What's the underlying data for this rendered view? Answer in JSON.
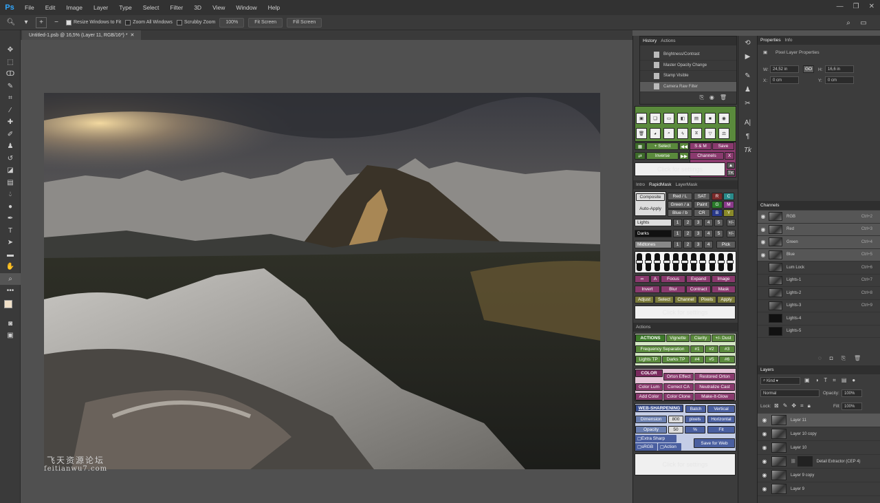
{
  "app": {
    "logo": "Ps"
  },
  "menu": [
    "File",
    "Edit",
    "Image",
    "Layer",
    "Type",
    "Select",
    "Filter",
    "3D",
    "View",
    "Window",
    "Help"
  ],
  "options": {
    "resize_windows": "Resize Windows to Fit",
    "zoom_all": "Zoom All Windows",
    "scrubby": "Scrubby Zoom",
    "zoom_value": "100%",
    "fit_screen": "Fit Screen",
    "fill_screen": "Fill Screen"
  },
  "document": {
    "tab_title": "Untitled-1.psb @ 16,5% (Layer 11, RGB/16*) *"
  },
  "watermark": {
    "line1": "飞天资源论坛",
    "line2": "feitianwu7.com"
  },
  "history": {
    "tabs": [
      "History",
      "Actions"
    ],
    "items": [
      "Brightness/Contrast",
      "Master Opacity Change",
      "Stamp Visible",
      "Camera Raw Filter"
    ],
    "selected_index": 3
  },
  "rapid": {
    "select": "+ Select",
    "sm": "S & M",
    "save": "Save",
    "inverse": "Inverse",
    "channels": "Channels",
    "x": "X",
    "click_settings": "Click for settings",
    "tabs": [
      "Intro",
      "RapidMask",
      "LayerMask"
    ],
    "composite": "Composite",
    "auto_apply": "Auto-Apply",
    "red": "Red / L",
    "green": "Green / a",
    "blue": "Blue / b",
    "sat": "SAT",
    "paint": "Paint",
    "cr": "CR",
    "lights": "Lights",
    "darks": "Darks",
    "midtones": "Midtones",
    "nums": [
      "1",
      "2",
      "3",
      "4",
      "5"
    ],
    "plus_minus": "+/-",
    "pick": "Pick",
    "row1": [
      "∞",
      "A",
      "Focus",
      "Expand",
      "Image"
    ],
    "row2": [
      "Invert",
      "Blur",
      "Contract",
      "Mask"
    ],
    "row3": [
      "Adjust",
      "Select",
      "Channel",
      "Pixels",
      "Apply"
    ],
    "click_settings2": "Click for settings"
  },
  "actions": {
    "title": "Actions",
    "actions_label": "ACTIONS",
    "vignette": "Vignette",
    "clarity": "Clarity",
    "dust": "+/- Dust",
    "freq": "Frequency Separation",
    "n1": "#1",
    "n2": "#2",
    "n3": "#3",
    "lights_tp": "Lights TP",
    "darks_tp": "Darks TP",
    "n4": "#4",
    "n5": "#5",
    "n6": "#6",
    "color_label": "COLOR",
    "orton": "Orton Effect",
    "restored": "Restored Orton",
    "color_lum": "Color Lum",
    "correct_ca": "Correct CA",
    "neutralize": "Neutralize Cast",
    "add_color": "Add Color",
    "color_clone": "Color Clone",
    "glow": "Make-It-Glow",
    "web_label": "WEB-SHARPENING",
    "batch": "Batch",
    "vertical": "Vertical",
    "dimension": "Dimension",
    "dim_val": "800",
    "pixels": "pixels",
    "horizontal": "Horizontal",
    "opacity": "Opacity",
    "op_val": "50",
    "pct": "%",
    "fit": "Fit",
    "extra_sharp": "Extra Sharp",
    "srgb": "sRGB",
    "action": "Action",
    "save_web": "Save for Web",
    "click_settings": "Click for settings"
  },
  "properties": {
    "tabs": [
      "Properties",
      "Info"
    ],
    "title": "Pixel Layer Properties",
    "w_label": "W:",
    "w": "24,52 in",
    "go": "GO",
    "h_label": "H:",
    "h": "16,6 in",
    "x_label": "X:",
    "x": "0 cm",
    "y_label": "Y:",
    "y": "0 cm"
  },
  "channels": {
    "title": "Channels",
    "rows": [
      {
        "name": "RGB",
        "key": "Ctrl+2",
        "vis": true
      },
      {
        "name": "Red",
        "key": "Ctrl+3",
        "vis": true
      },
      {
        "name": "Green",
        "key": "Ctrl+4",
        "vis": true
      },
      {
        "name": "Blue",
        "key": "Ctrl+5",
        "vis": true
      },
      {
        "name": "Lum Lock",
        "key": "Ctrl+6",
        "vis": false
      },
      {
        "name": "Lights-1",
        "key": "Ctrl+7",
        "vis": false
      },
      {
        "name": "Lights-2",
        "key": "Ctrl+8",
        "vis": false
      },
      {
        "name": "Lights-3",
        "key": "Ctrl+9",
        "vis": false
      },
      {
        "name": "Lights-4",
        "key": "",
        "vis": false
      },
      {
        "name": "Lights-5",
        "key": "",
        "vis": false
      }
    ]
  },
  "layers": {
    "title": "Layers",
    "kind": "Kind",
    "blend": "Normal",
    "opacity_label": "Opacity:",
    "opacity": "100%",
    "lock_label": "Lock:",
    "fill_label": "Fill:",
    "fill": "100%",
    "rows": [
      "Layer 11",
      "Layer 10 copy",
      "Layer 10",
      "Detail Extractor  (CEP 4)",
      "Layer 9 copy",
      "Layer 9"
    ]
  }
}
